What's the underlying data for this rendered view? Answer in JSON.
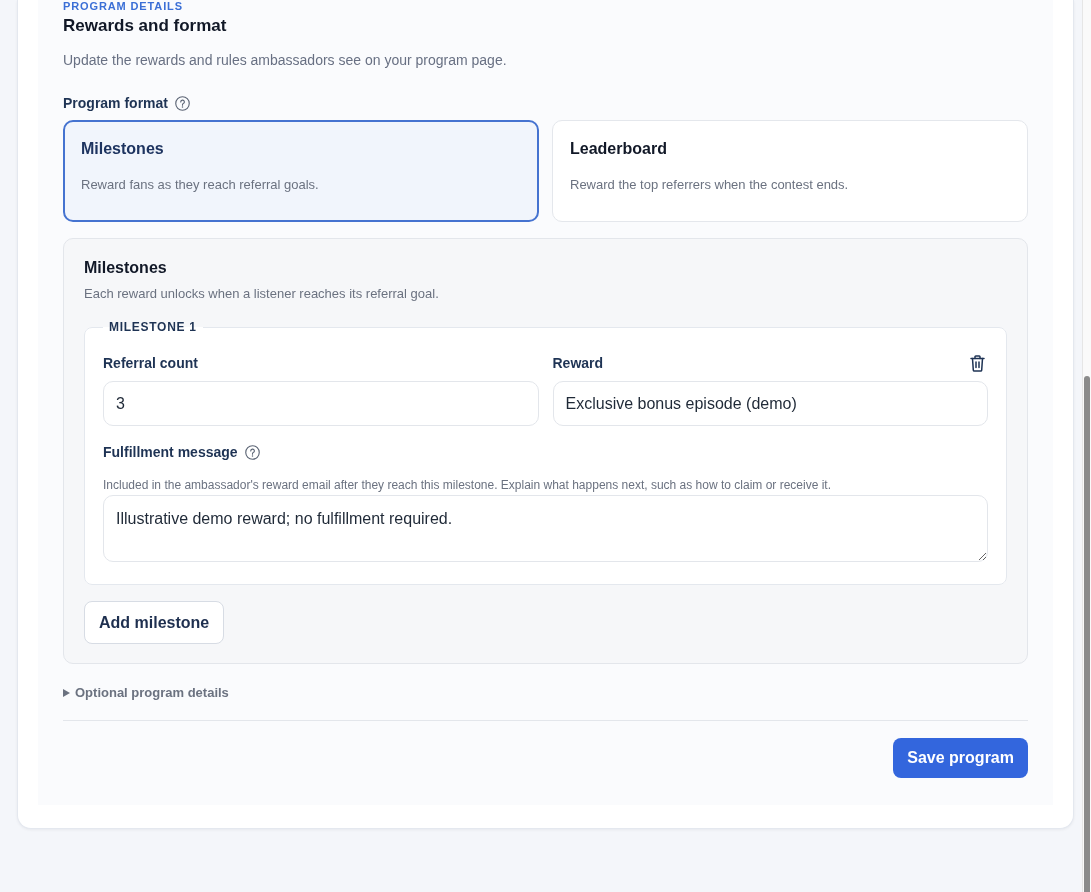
{
  "section": {
    "eyebrow": "PROGRAM DETAILS",
    "title": "Rewards and format",
    "description": "Update the rewards and rules ambassadors see on your program page."
  },
  "program_format": {
    "label": "Program format",
    "options": [
      {
        "title": "Milestones",
        "description": "Reward fans as they reach referral goals.",
        "selected": true
      },
      {
        "title": "Leaderboard",
        "description": "Reward the top referrers when the contest ends.",
        "selected": false
      }
    ]
  },
  "milestones_panel": {
    "title": "Milestones",
    "description": "Each reward unlocks when a listener reaches its referral goal.",
    "milestones": [
      {
        "legend": "MILESTONE 1",
        "referral_count": {
          "label": "Referral count",
          "value": "3"
        },
        "reward": {
          "label": "Reward",
          "value": "Exclusive bonus episode (demo)"
        },
        "fulfillment_message": {
          "label": "Fulfillment message",
          "help": "Included in the ambassador's reward email after they reach this milestone. Explain what happens next, such as how to claim or receive it.",
          "value": "Illustrative demo reward; no fulfillment required."
        }
      }
    ],
    "add_button": "Add milestone"
  },
  "optional_details": {
    "label": "Optional program details",
    "expanded": false
  },
  "save_button": "Save program"
}
